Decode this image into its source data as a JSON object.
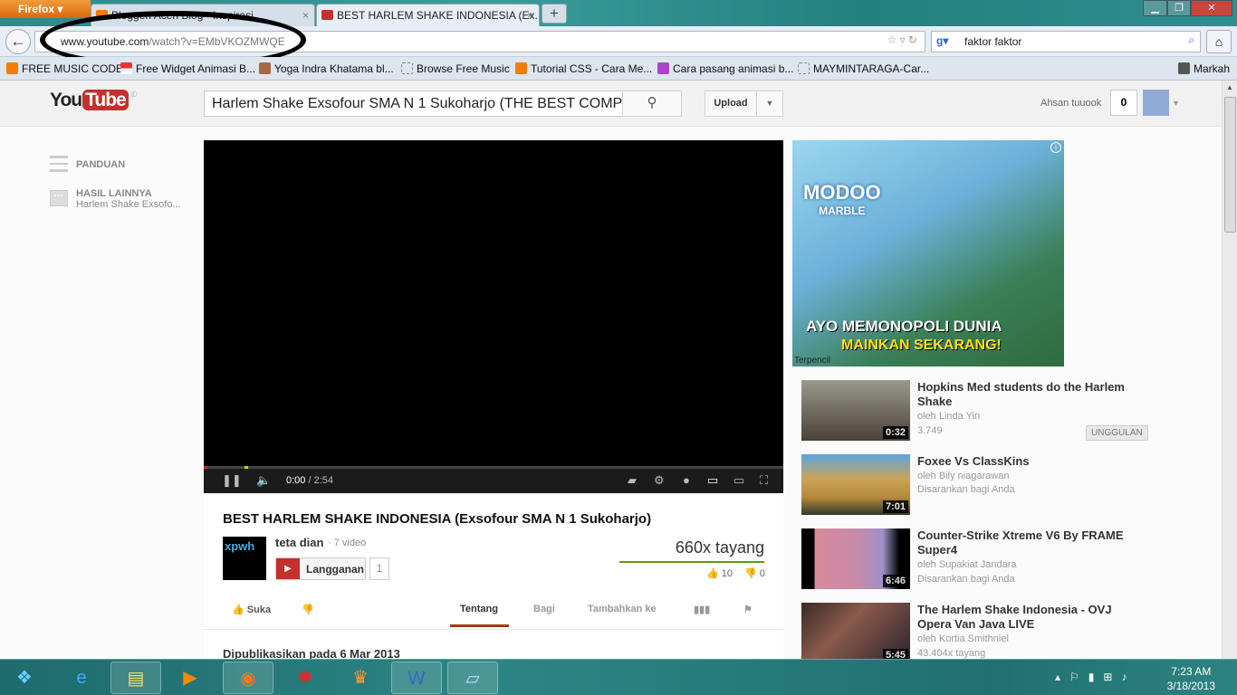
{
  "browser": {
    "menu_label": "Firefox",
    "tabs": [
      {
        "label": "Bloggeri Aceh Blog - Inspirasi"
      },
      {
        "label": "BEST HARLEM SHAKE INDONESIA (Ex..."
      }
    ],
    "url_domain": "www.youtube.com",
    "url_path": "/watch?v=EMbVKOZMWQE",
    "search_value": "faktor faktor",
    "bookmarks": [
      {
        "label": "FREE MUSIC CODE",
        "color": "#f57c00"
      },
      {
        "label": "Free Widget Animasi B...",
        "color": "#e33"
      },
      {
        "label": "Yoga Indra Khatama bl...",
        "color": "#a64"
      },
      {
        "label": "Browse Free Music",
        "color": "#fff"
      },
      {
        "label": "Tutorial CSS - Cara Me...",
        "color": "#f57c00"
      },
      {
        "label": "Cara pasang animasi b...",
        "color": "#a4c"
      },
      {
        "label": "MAYMINTARAGA-Car...",
        "color": "#fff"
      }
    ],
    "bookmarks_menu": "Markah"
  },
  "youtube": {
    "logo_you": "You",
    "logo_tube": "Tube",
    "region": "ID",
    "search_value": "Harlem Shake Exsofour SMA N 1 Sukoharjo (THE BEST COMPILATION)",
    "upload_label": "Upload",
    "username": "Ahsan tuuook",
    "notifications": "0",
    "sidebar": {
      "guide": "PANDUAN",
      "more_results": "HASIL LAINNYA",
      "more_results_sub": "Harlem Shake Exsofo..."
    }
  },
  "player": {
    "time_current": "0:00",
    "time_total": "2:54",
    "progress": 0.0,
    "buffered": 0.07
  },
  "video": {
    "title": "BEST HARLEM SHAKE INDONESIA (Exsofour SMA N 1 Sukoharjo)",
    "channel": "teta dian",
    "channel_videos": "7 video",
    "channel_logo": "xpwh",
    "subscribe_label": "Langganan",
    "subscribers": "1",
    "views": "660x tayang",
    "likes": "10",
    "dislikes": "0",
    "like_ratio": 1.0,
    "like_label": "Suka",
    "tabs": [
      "Tentang",
      "Bagi",
      "Tambahkan ke"
    ],
    "active_tab": "Tentang",
    "published": "Dipublikasikan pada 6 Mar 2013"
  },
  "ad": {
    "brand": "MODOO",
    "brand_sub": "MARBLE",
    "line1": "AYO MEMONOPOLI DUNIA",
    "line2": "MAINKAN SEKARANG!",
    "footer": "Terpencil"
  },
  "related": [
    {
      "title": "Hopkins Med students do the Harlem Shake",
      "by": "oleh Linda Yin",
      "meta": "3.749",
      "duration": "0:32",
      "badge": "UNGGULAN"
    },
    {
      "title": "Foxee Vs ClassKins",
      "by": "oleh Bily niagarawan",
      "meta": "Disarankan bagi Anda",
      "duration": "7:01"
    },
    {
      "title": "Counter-Strike Xtreme V6 By FRAME Super4",
      "by": "oleh Supakiat Jandara",
      "meta": "Disarankan bagi Anda",
      "duration": "6:46"
    },
    {
      "title": "The Harlem Shake Indonesia - OVJ Opera Van Java LIVE",
      "by": "oleh Kortia Smithniel",
      "meta": "43.404x tayang",
      "duration": "5:45"
    }
  ],
  "taskbar": {
    "time": "7:23 AM",
    "date": "3/18/2013"
  }
}
